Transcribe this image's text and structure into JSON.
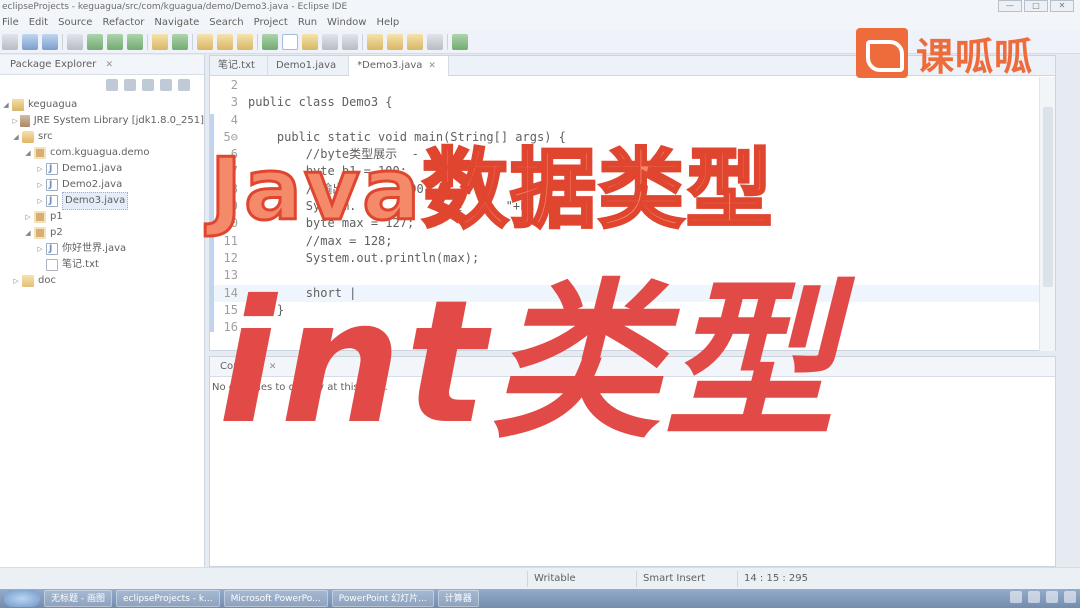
{
  "window": {
    "title": "eclipseProjects - keguagua/src/com/kguagua/demo/Demo3.java - Eclipse IDE",
    "controls": [
      "—",
      "□",
      "✕"
    ]
  },
  "menu": [
    "File",
    "Edit",
    "Source",
    "Refactor",
    "Navigate",
    "Search",
    "Project",
    "Run",
    "Window",
    "Help"
  ],
  "explorer": {
    "title": "Package Explorer",
    "items": [
      {
        "label": "keguagua",
        "icon": "project-icon"
      },
      {
        "label": "JRE System Library [jdk1.8.0_251]",
        "icon": "library-icon"
      },
      {
        "label": "src",
        "icon": "source-folder-icon"
      },
      {
        "label": "com.kguagua.demo",
        "icon": "package-icon"
      },
      {
        "label": "Demo1.java",
        "icon": "java-file-icon"
      },
      {
        "label": "Demo2.java",
        "icon": "java-file-icon"
      },
      {
        "label": "Demo3.java",
        "icon": "java-file-icon"
      },
      {
        "label": "p1",
        "icon": "package-icon"
      },
      {
        "label": "p2",
        "icon": "package-icon"
      },
      {
        "label": "你好世界.java",
        "icon": "java-file-icon"
      },
      {
        "label": "笔记.txt",
        "icon": "text-file-icon"
      },
      {
        "label": "doc",
        "icon": "folder-icon"
      }
    ]
  },
  "editor": {
    "tabs": [
      "笔记.txt",
      "Demo1.java",
      "*Demo3.java"
    ],
    "lines": [
      {
        "num": "2",
        "text": ""
      },
      {
        "num": "3",
        "text": "public class Demo3 {"
      },
      {
        "num": "4",
        "text": ""
      },
      {
        "num": "5⊖",
        "text": "    public static void main(String[] args) {"
      },
      {
        "num": "6",
        "text": "        //byte类型展示  -"
      },
      {
        "num": "7",
        "text": "        byte b1 = 100;"
      },
      {
        "num": "8",
        "text": "        //输出        100     用"
      },
      {
        "num": "9",
        "text": "        System.             类      \"+b1"
      },
      {
        "num": "10",
        "text": "        byte max = 127;"
      },
      {
        "num": "11",
        "text": "        //max = 128;"
      },
      {
        "num": "12",
        "text": "        System.out.println(max);"
      },
      {
        "num": "13",
        "text": ""
      },
      {
        "num": "14",
        "text": "        short |"
      },
      {
        "num": "15",
        "text": "    }"
      },
      {
        "num": "16",
        "text": ""
      }
    ]
  },
  "console": {
    "title": "Console",
    "message": "No consoles to display at this time."
  },
  "status": {
    "writable": "Writable",
    "insert_mode": "Smart Insert",
    "position": "14 : 15 : 295"
  },
  "taskbar": {
    "items": [
      "无标题 - 画图",
      "eclipseProjects - k...",
      "Microsoft PowerPo...",
      "PowerPoint 幻灯片...",
      "计算器"
    ]
  },
  "overlay": {
    "brand": "课呱呱",
    "title": "Java数据类型",
    "subtitle": "int类型"
  }
}
